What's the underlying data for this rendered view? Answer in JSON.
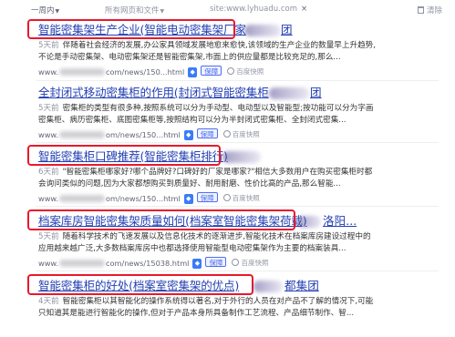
{
  "filters": {
    "time_label": "一周内",
    "web_label": "所有网页和文件",
    "site_label": "site:www.lyhuadu.com",
    "clear_label": "清除"
  },
  "results": [
    {
      "title": "智能密集架生产企业(智能电动密集架厂家",
      "title_suffix": "团",
      "snippet_age": "5天前",
      "snippet_line1": "伴随着社会经济的发展,办公家具领域发展地愈来愈快,该领域的生产企业的数量早上升趋势,",
      "snippet_line2": "不论是手动密集架、电动密集架还是智能密集架,市面上的供应量都是比较充足的,那么...",
      "url": "www.",
      "url_tail": "com/news/150...html",
      "shield_icon": "◆",
      "badge": "保障",
      "kuaizhao": "百度快照",
      "highlighted": true
    },
    {
      "title": "全封闭式移动密集柜的作用(封闭式智能密集柜",
      "title_suffix": "团",
      "snippet_age": "5天前",
      "snippet_line1": "密集柜的类型有很多种,按照系统可以分为手动型、电动型以及智能型;按功能可以分为字画",
      "snippet_line2": "密集柜、病历密集柜、底图密集柜等,按照结构可以分为半封闭式密集柜、全封闭式密集...",
      "url": "www.",
      "url_tail": "om/news/150...html",
      "shield_icon": "◆",
      "badge": "保障",
      "kuaizhao": "百度快照",
      "highlighted": false
    },
    {
      "title": "智能密集柜口碑推荐(智能密集柜排行)",
      "title_suffix": "",
      "snippet_age": "6天前",
      "snippet_line1": "\"智能密集柜哪家好?哪个品牌好?口碑好的厂家是哪家?\"相信大多数用户在购买密集柜时都",
      "snippet_line2": "会询问类似的问题,因为大家都想购买到质量好、耐用耐磨、性价比高的产品,那么智能...",
      "url": "www.",
      "url_tail": "om/news/150...html",
      "shield_icon": "◆",
      "badge": "保障",
      "kuaizhao": "百度快照",
      "highlighted": true
    },
    {
      "title": "档案库房智能密集架质量如何(档案室智能密集架荷载)",
      "title_suffix": "洛阳...",
      "snippet_age": "5天前",
      "snippet_line1": "随着科学技术的飞速发展以及信息化技术的逐渐进步,智能化技术在档案库房建设过程中的",
      "snippet_line2": "应用越来越广泛,大多数档案库房中也都选择使用智能型电动密集架作为主要的档案装具...",
      "url": "www.",
      "url_tail": "com/news/15038.html",
      "shield_icon": "◆",
      "badge": "保障",
      "kuaizhao": "百度快照",
      "highlighted": true
    },
    {
      "title": "智能密集柜的好处(档案室密集架的优点)",
      "title_suffix": "都集团",
      "snippet_age": "4天前",
      "snippet_line1": "智能密集柜以其智能化的操作系统得以著名,对于外行的人员在对产品不了解的情况下,可能",
      "snippet_line2": "只知道其是能进行智能化的操作,但对于产品本身所具备制作工艺流程、产品细节制作、智...",
      "url": "",
      "url_tail": "",
      "shield_icon": "",
      "badge": "",
      "kuaizhao": "",
      "highlighted": true
    }
  ]
}
